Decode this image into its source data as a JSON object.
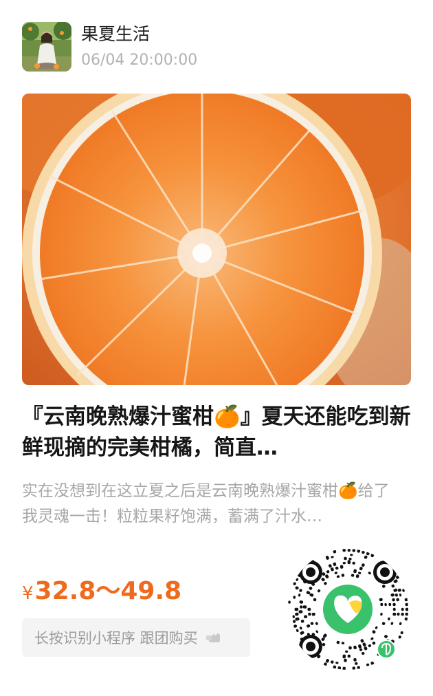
{
  "author": {
    "name": "果夏生活",
    "time": "06/04 20:00:00",
    "avatar_icon": "avatar-photo-woman-in-orchard"
  },
  "post": {
    "image_icon": "sliced-orange-photo",
    "title": "『云南晚熟爆汁蜜柑🍊』夏天还能吃到新鲜现摘的完美柑橘，简直…",
    "description": "实在没想到在这立夏之后是云南晚熟爆汁蜜柑🍊给了我灵魂一击！粒粒果籽饱满，蓄满了汁水…"
  },
  "price": {
    "currency": "¥",
    "range": "32.8～49.8"
  },
  "cta": {
    "label": "长按识别小程序 跟团购买",
    "icon": "hand-pointing-icon"
  },
  "qr": {
    "icon": "mini-program-code",
    "center_logo": "heart-logo-icon",
    "badge_icon": "mini-program-badge-icon"
  },
  "colors": {
    "price": "#f06a1e",
    "title": "#161616",
    "desc": "#a7a7a7",
    "qr_center": "#39c16c",
    "qr_logo_accent": "#ffd43b"
  }
}
